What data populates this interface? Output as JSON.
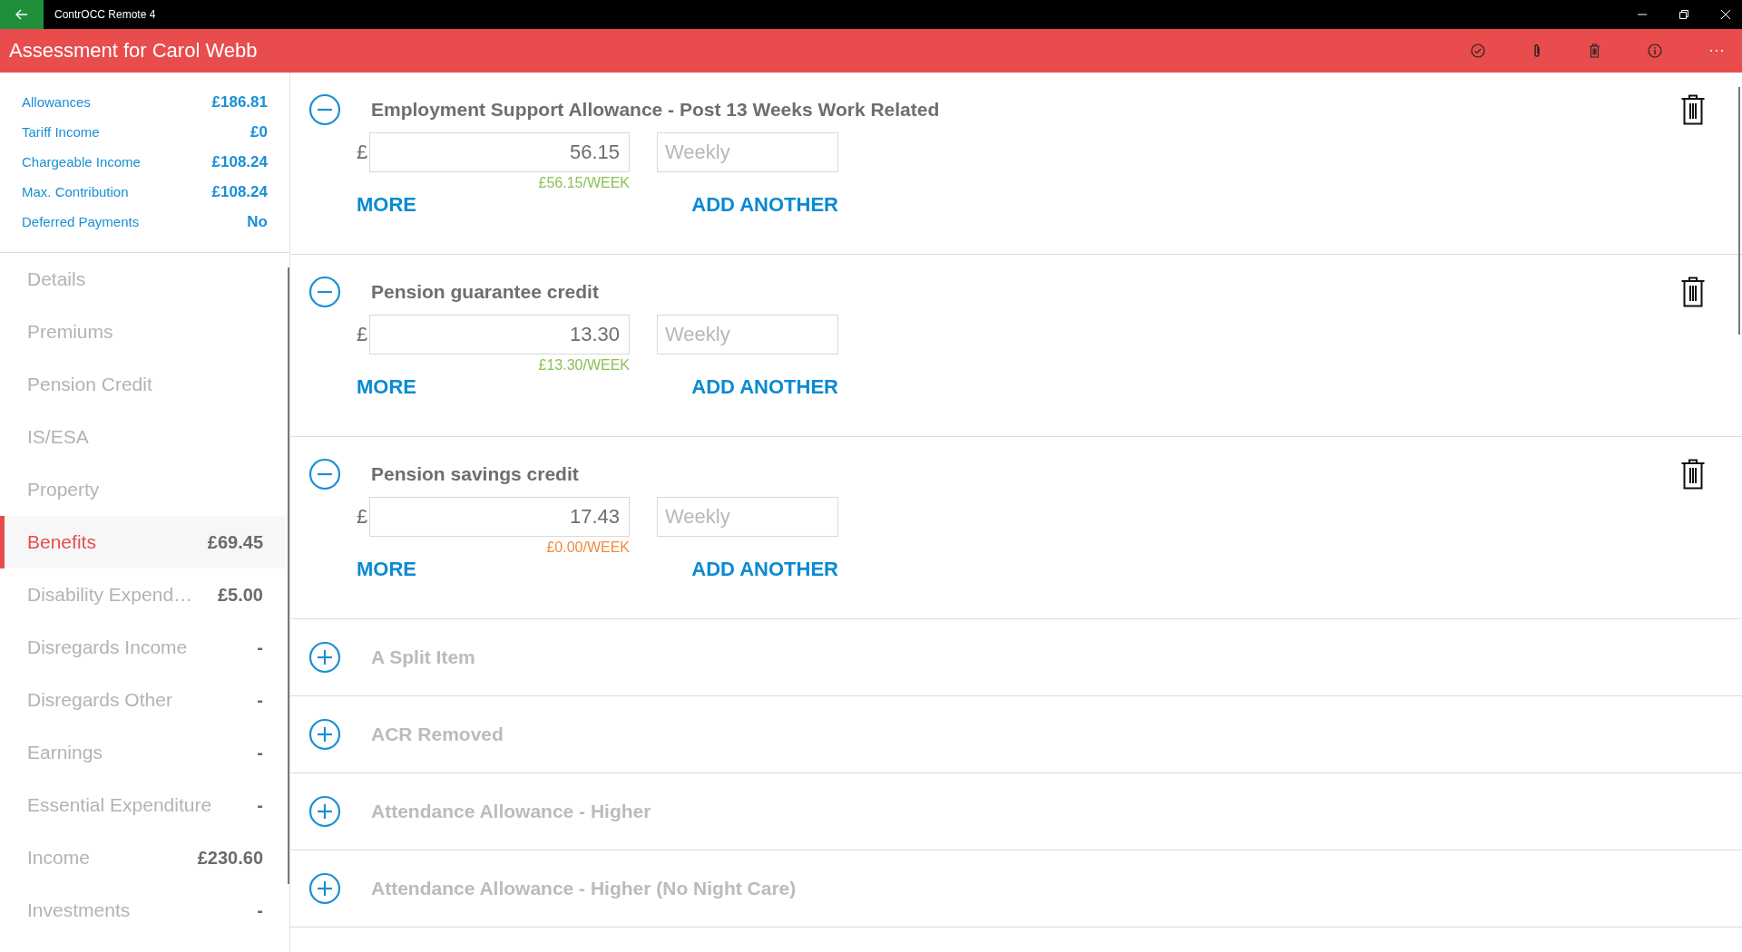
{
  "window": {
    "title": "ContrOCC Remote 4"
  },
  "header": {
    "title": "Assessment for Carol Webb"
  },
  "summary": [
    {
      "label": "Allowances",
      "value": "£186.81"
    },
    {
      "label": "Tariff Income",
      "value": "£0"
    },
    {
      "label": "Chargeable Income",
      "value": "£108.24"
    },
    {
      "label": "Max. Contribution",
      "value": "£108.24"
    },
    {
      "label": "Deferred Payments",
      "value": "No"
    }
  ],
  "nav": [
    {
      "label": "Details",
      "selected": false
    },
    {
      "label": "Premiums",
      "selected": false
    },
    {
      "label": "Pension Credit",
      "selected": false
    },
    {
      "label": "IS/ESA",
      "selected": false
    },
    {
      "label": "Property",
      "selected": false
    },
    {
      "label": "Benefits",
      "value": "£69.45",
      "selected": true
    },
    {
      "label": "Disability Expend…",
      "value": "£5.00",
      "selected": false
    },
    {
      "label": "Disregards Income",
      "value": "-",
      "selected": false
    },
    {
      "label": "Disregards Other",
      "value": "-",
      "selected": false
    },
    {
      "label": "Earnings",
      "value": "-",
      "selected": false
    },
    {
      "label": "Essential Expenditure",
      "value": "-",
      "selected": false
    },
    {
      "label": "Income",
      "value": "£230.60",
      "selected": false
    },
    {
      "label": "Investments",
      "value": "-",
      "selected": false
    }
  ],
  "items": [
    {
      "title": "Employment Support Allowance - Post 13 Weeks Work Related",
      "expanded": true,
      "currency": "£",
      "amount": "56.15",
      "frequency_placeholder": "Weekly",
      "weekly": "£56.15/WEEK",
      "color": "#8dc152",
      "more": "MORE",
      "add": "ADD ANOTHER"
    },
    {
      "title": "Pension guarantee credit",
      "expanded": true,
      "currency": "£",
      "amount": "13.30",
      "frequency_placeholder": "Weekly",
      "weekly": "£13.30/WEEK",
      "color": "#8dc152",
      "more": "MORE",
      "add": "ADD ANOTHER"
    },
    {
      "title": "Pension savings credit",
      "expanded": true,
      "currency": "£",
      "amount": "17.43",
      "frequency_placeholder": "Weekly",
      "weekly": "£0.00/WEEK",
      "color": "#f08a3c",
      "more": "MORE",
      "add": "ADD ANOTHER"
    },
    {
      "title": "A Split Item",
      "expanded": false
    },
    {
      "title": "ACR Removed",
      "expanded": false
    },
    {
      "title": "Attendance Allowance - Higher",
      "expanded": false
    },
    {
      "title": "Attendance Allowance - Higher (No Night Care)",
      "expanded": false
    }
  ]
}
